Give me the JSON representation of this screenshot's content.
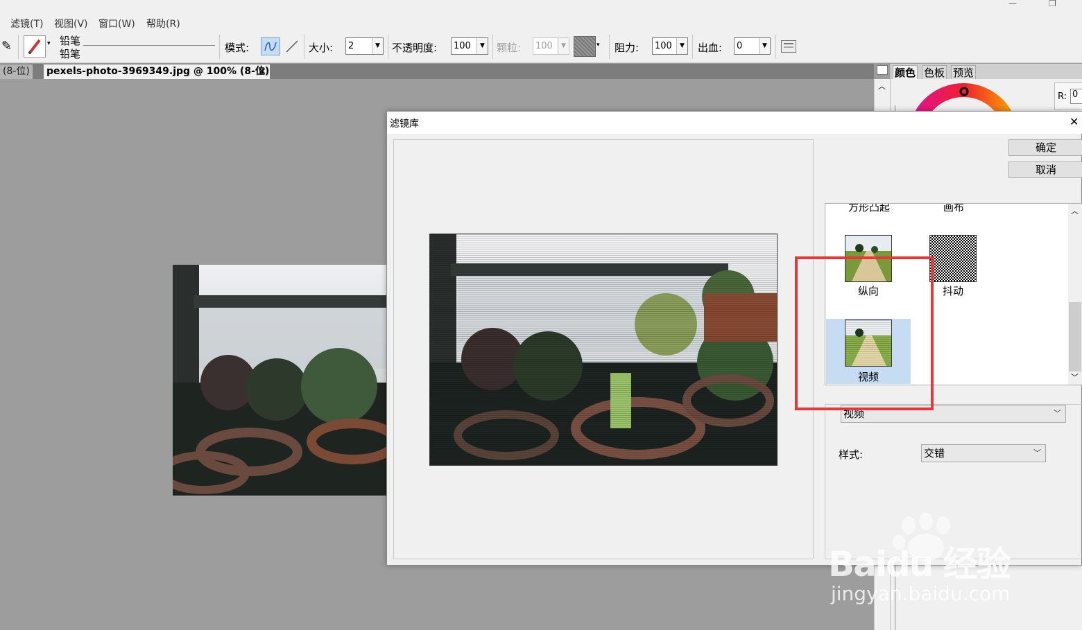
{
  "menubar": {
    "items": [
      "滤镜(T)",
      "视图(V)",
      "窗口(W)",
      "帮助(R)"
    ]
  },
  "toolbar": {
    "tool_name_1": "铅笔",
    "tool_name_2": "铅笔",
    "mode_label": "模式:",
    "size_label": "大小:",
    "size_value": "2",
    "opacity_label": "不透明度:",
    "opacity_value": "100",
    "grain_label": "颗粒:",
    "grain_value": "100",
    "resistance_label": "阻力:",
    "resistance_value": "100",
    "bleed_label": "出血:",
    "bleed_value": "0"
  },
  "document": {
    "prev_tab": "(8-位)",
    "active_tab": "pexels-photo-3969349.jpg @ 100% (8-位)",
    "close": "×"
  },
  "panel": {
    "tabs": [
      "颜色",
      "色板",
      "预览"
    ],
    "r_label": "R:",
    "r_value": "0"
  },
  "dialog": {
    "title": "滤镜库",
    "close": "✕",
    "ok": "确定",
    "cancel": "取消",
    "filters_partial": [
      "方形凸起",
      "画布"
    ],
    "filters": [
      {
        "label": "纵向",
        "selected": false
      },
      {
        "label": "抖动",
        "selected": false
      },
      {
        "label": "视频",
        "selected": true
      }
    ],
    "filter_dropdown": "视频",
    "style_label": "样式:",
    "style_value": "交错"
  },
  "watermark": {
    "brand": "Baidu 经验",
    "url": "jingyan.baidu.com"
  },
  "colors": {
    "accent_highlight": "#e23a3a",
    "selection": "#c5dcf3"
  }
}
